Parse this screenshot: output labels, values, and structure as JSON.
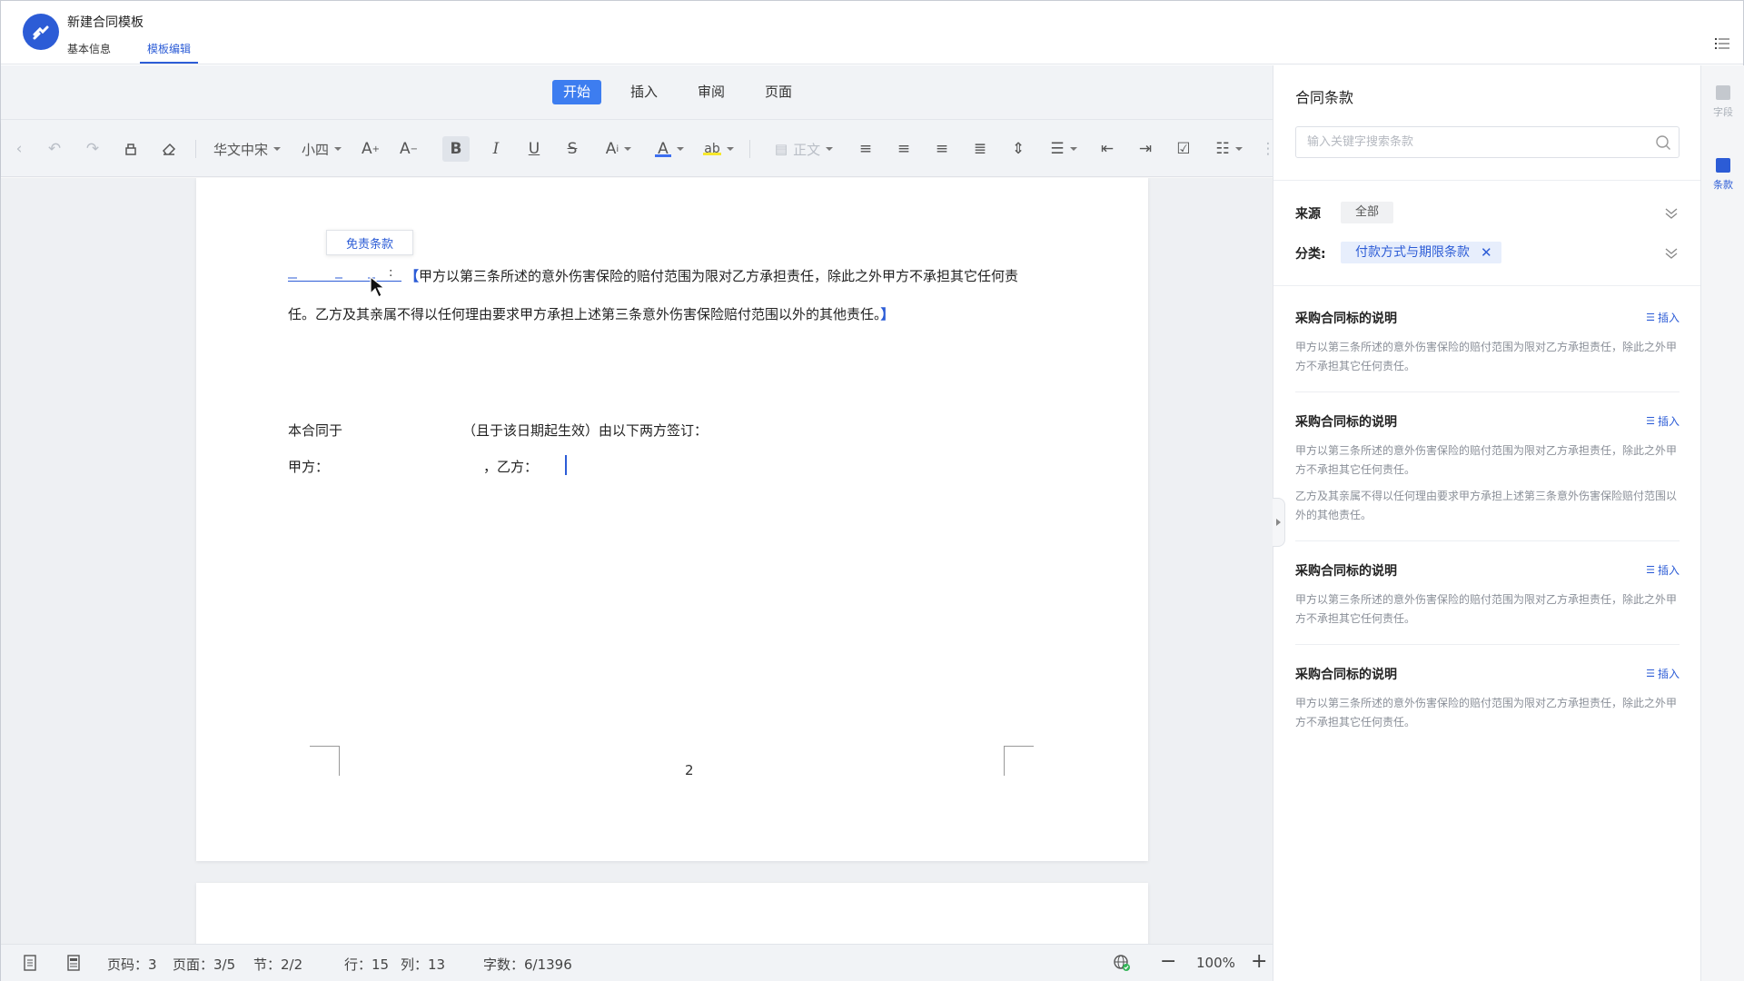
{
  "header": {
    "doc_title": "新建合同模板",
    "tabs": [
      {
        "label": "基本信息",
        "active": false
      },
      {
        "label": "模板编辑",
        "active": true
      }
    ]
  },
  "menu": {
    "tabs": [
      {
        "label": "开始",
        "active": true
      },
      {
        "label": "插入",
        "active": false
      },
      {
        "label": "审阅",
        "active": false
      },
      {
        "label": "页面",
        "active": false
      }
    ]
  },
  "toolbar": {
    "font_family": "华文中宋",
    "font_size": "小四",
    "paragraph_style": "正文",
    "font_color": "#3d6ff0",
    "highlight_color": "#f7e82d"
  },
  "document": {
    "tooltip": "免责条款",
    "field_colon": ":",
    "line1_open": "【",
    "line1_text": "甲方以第三条所述的意外伤害保险的赔付范围为限对乙方承担责任，除此之外甲方不承担其它任何责",
    "line2_text": "任。乙方及其亲属不得以任何理由要求甲方承担上述第三条意外伤害保险赔付范围以外的其他责任。",
    "line2_close": "】",
    "sign_line1_a": "本合同于",
    "sign_line1_b": "（且于该日期起生效）由以下两方签订：",
    "sign_line2_a": "甲方：",
    "sign_line2_b": "，乙方：",
    "page_number": "2"
  },
  "statusbar": {
    "page_code": "页码：3",
    "pages": "页面：3/5",
    "section": "节：2/2",
    "row": "行：15",
    "col": "列：13",
    "word_count": "字数：6/1396",
    "zoom": "100%",
    "zoom_out": "−",
    "zoom_in": "+"
  },
  "panel": {
    "title": "合同条款",
    "search_placeholder": "输入关键字搜索条款",
    "source_label": "来源",
    "source_value": "全部",
    "category_label": "分类:",
    "category_value": "付款方式与期限条款",
    "category_close": "✕",
    "insert_label": "插入",
    "clauses": [
      {
        "title": "采购合同标的说明",
        "paragraphs": [
          "甲方以第三条所述的意外伤害保险的赔付范围为限对乙方承担责任，除此之外甲方不承担其它任何责任。"
        ]
      },
      {
        "title": "采购合同标的说明",
        "paragraphs": [
          "甲方以第三条所述的意外伤害保险的赔付范围为限对乙方承担责任，除此之外甲方不承担其它任何责任。",
          "乙方及其亲属不得以任何理由要求甲方承担上述第三条意外伤害保险赔付范围以外的其他责任。"
        ]
      },
      {
        "title": "采购合同标的说明",
        "paragraphs": [
          "甲方以第三条所述的意外伤害保险的赔付范围为限对乙方承担责任，除此之外甲方不承担其它任何责任。"
        ]
      },
      {
        "title": "采购合同标的说明",
        "paragraphs": [
          "甲方以第三条所述的意外伤害保险的赔付范围为限对乙方承担责任，除此之外甲方不承担其它任何责任。"
        ]
      }
    ]
  },
  "rail": {
    "items": [
      {
        "label": "字段",
        "active": false
      },
      {
        "label": "条款",
        "active": true
      }
    ]
  },
  "colors": {
    "accent": "#2c5cd6",
    "menu_active": "#3d7df0"
  }
}
